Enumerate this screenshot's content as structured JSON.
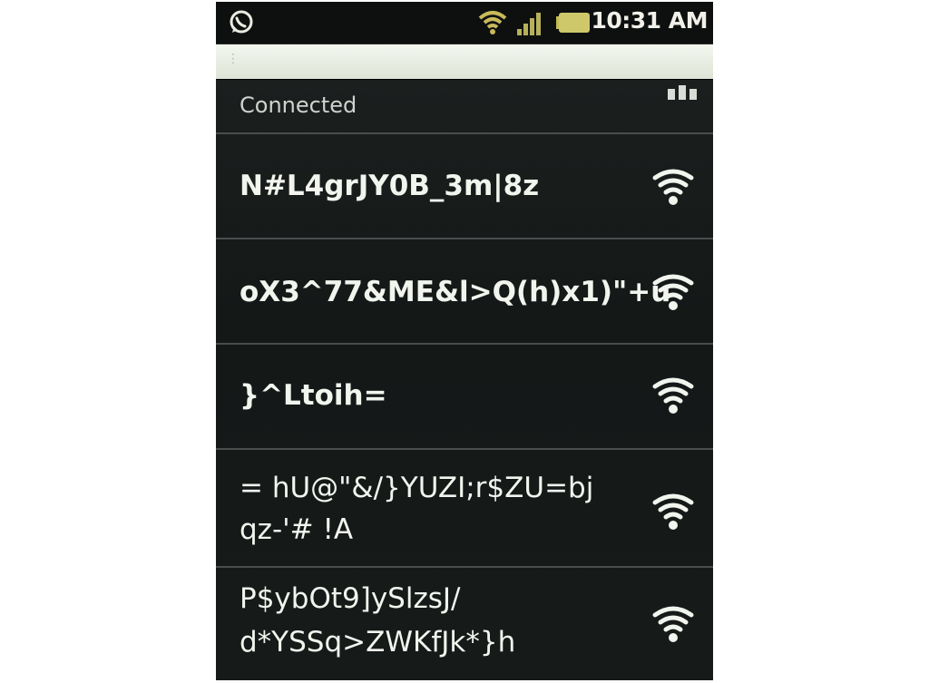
{
  "status_bar": {
    "time": "10:31 AM",
    "icons": [
      "whatsapp-icon",
      "wifi-icon",
      "signal-icon",
      "battery-icon"
    ]
  },
  "connected_section": {
    "label": "Connected"
  },
  "networks": [
    {
      "lines": [
        "N#L4grJY0B_3m|8z"
      ],
      "icon": "wifi-signal-icon"
    },
    {
      "lines": [
        "oX3^77&ME&l>Q(h)x1)\"+u"
      ],
      "icon": "wifi-signal-icon"
    },
    {
      "lines": [
        "}^Ltoih="
      ],
      "icon": "wifi-signal-icon"
    },
    {
      "lines": [
        "= hU@\"&/}YUZI;r$ZU=bj",
        "qz-'# !A"
      ],
      "icon": "wifi-signal-icon"
    },
    {
      "lines": [
        "P$ybOt9]ySlzsJ/",
        "d*YSSq>ZWKfJk*}h"
      ],
      "icon": "wifi-signal-icon"
    }
  ],
  "colors": {
    "background": "#000000",
    "text": "#f2f4ee",
    "divider": "#4a4d4c",
    "accent_status": "#f1f1e9"
  }
}
